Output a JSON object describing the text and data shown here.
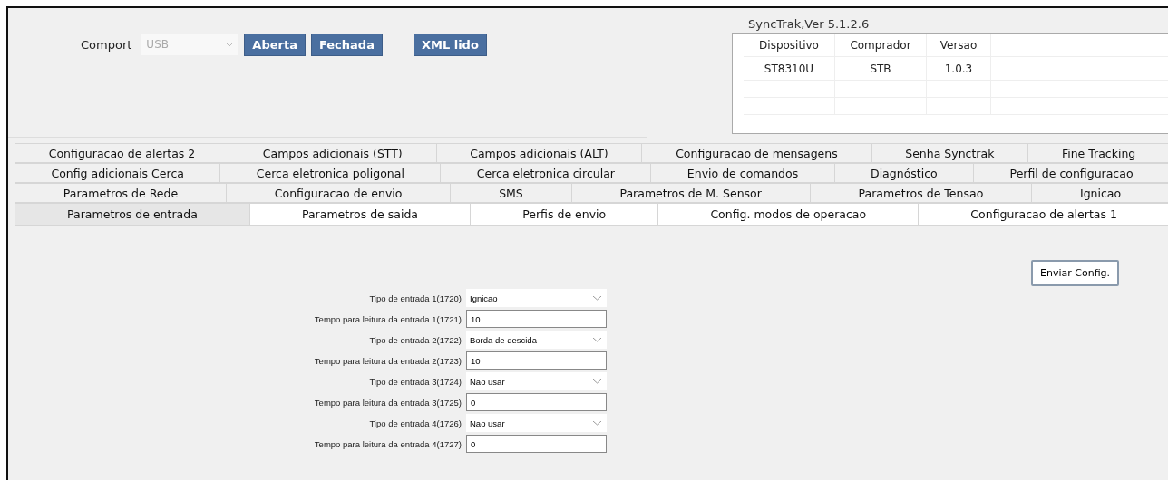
{
  "connection": {
    "comport_label": "Comport",
    "comport": {
      "value": "USB",
      "disabled": true
    },
    "buttons": [
      "Aberta",
      "Fechada",
      "XML lido"
    ]
  },
  "device_info": {
    "title": "SyncTrak,Ver 5.1.2.6",
    "columns": [
      "Dispositivo",
      "Comprador",
      "Versao"
    ],
    "rows": [
      [
        "ST8310U",
        "STB",
        "1.0.3"
      ]
    ]
  },
  "tab_rows": [
    [
      {
        "label": "Configuracao de alertas 2",
        "selected": false
      },
      {
        "label": "Campos adicionais (STT)",
        "selected": false
      },
      {
        "label": "Campos adicionais (ALT)",
        "selected": false
      },
      {
        "label": "Configuracao de mensagens",
        "selected": false
      },
      {
        "label": "Senha Synctrak",
        "selected": false
      },
      {
        "label": "Fine Tracking",
        "selected": false
      }
    ],
    [
      {
        "label": "Config adicionais Cerca",
        "selected": false
      },
      {
        "label": "Cerca eletronica poligonal",
        "selected": false
      },
      {
        "label": "Cerca eletronica circular",
        "selected": false
      },
      {
        "label": "Envio de comandos",
        "selected": false
      },
      {
        "label": "Diagnóstico",
        "selected": false
      },
      {
        "label": "Perfil de configuracao",
        "selected": false
      }
    ],
    [
      {
        "label": "Parametros de Rede",
        "selected": false
      },
      {
        "label": "Configuracao de envio",
        "selected": false
      },
      {
        "label": "SMS",
        "selected": false
      },
      {
        "label": "Parametros de M. Sensor",
        "selected": false
      },
      {
        "label": "Parametros de Tensao",
        "selected": false
      },
      {
        "label": "Ignicao",
        "selected": false
      }
    ],
    [
      {
        "label": "Parametros de entrada",
        "selected": true
      },
      {
        "label": "Parametros de saida",
        "selected": false
      },
      {
        "label": "Perfis de envio",
        "selected": false
      },
      {
        "label": "Config. modos de operacao",
        "selected": false
      },
      {
        "label": "Configuracao de alertas 1",
        "selected": false
      }
    ]
  ],
  "send_button": "Enviar Config.",
  "fields": [
    {
      "label": "Tipo de entrada 1(1720)",
      "kind": "select",
      "value": "Ignicao"
    },
    {
      "label": "Tempo para leitura da entrada 1(1721)",
      "kind": "text",
      "value": "10"
    },
    {
      "label": "Tipo de entrada 2(1722)",
      "kind": "select",
      "value": "Borda de descida"
    },
    {
      "label": "Tempo para leitura da entrada 2(1723)",
      "kind": "text",
      "value": "10"
    },
    {
      "label": "Tipo de entrada 3(1724)",
      "kind": "select",
      "value": "Nao usar"
    },
    {
      "label": "Tempo para leitura da entrada 3(1725)",
      "kind": "text",
      "value": "0"
    },
    {
      "label": "Tipo de entrada 4(1726)",
      "kind": "select",
      "value": "Nao usar"
    },
    {
      "label": "Tempo para leitura da entrada 4(1727)",
      "kind": "text",
      "value": "0"
    }
  ]
}
